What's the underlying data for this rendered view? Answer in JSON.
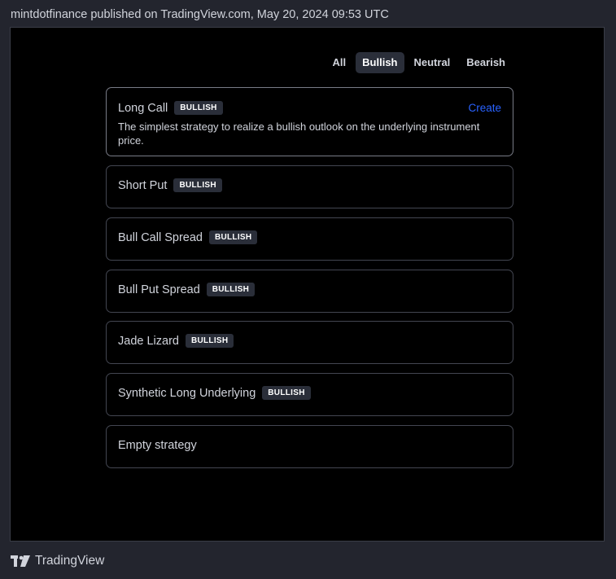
{
  "header": {
    "published_line": "mintdotfinance published on TradingView.com, May 20, 2024 09:53 UTC"
  },
  "filters": [
    {
      "label": "All",
      "active": false
    },
    {
      "label": "Bullish",
      "active": true
    },
    {
      "label": "Neutral",
      "active": false
    },
    {
      "label": "Bearish",
      "active": false
    }
  ],
  "strategies": [
    {
      "name": "Long Call",
      "badge": "BULLISH",
      "action": "Create",
      "description": "The simplest strategy to realize a bullish outlook on the underlying instrument price."
    },
    {
      "name": "Short Put",
      "badge": "BULLISH"
    },
    {
      "name": "Bull Call Spread",
      "badge": "BULLISH"
    },
    {
      "name": "Bull Put Spread",
      "badge": "BULLISH"
    },
    {
      "name": "Jade Lizard",
      "badge": "BULLISH"
    },
    {
      "name": "Synthetic Long Underlying",
      "badge": "BULLISH"
    },
    {
      "name": "Empty strategy"
    }
  ],
  "footer": {
    "brand": "TradingView",
    "logo_icon": "tradingview-logo-icon"
  },
  "colors": {
    "background": "#23252e",
    "panel": "#000000",
    "accent_link": "#2962ff",
    "badge_bg": "#2a2e39"
  }
}
